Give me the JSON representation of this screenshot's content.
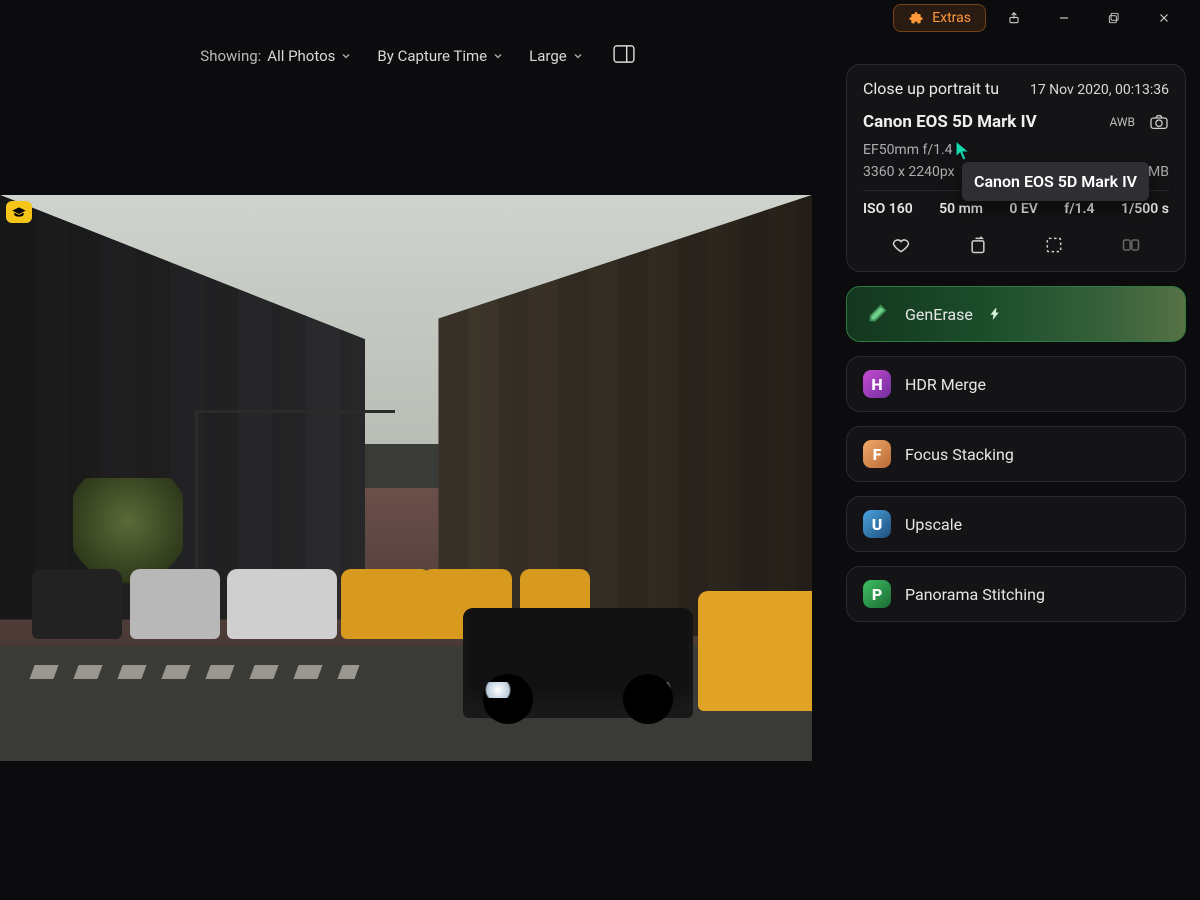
{
  "titlebar": {
    "extras_label": "Extras"
  },
  "toolbar": {
    "showing_prefix": "Showing:",
    "filter": "All Photos",
    "sort": "By Capture Time",
    "size": "Large"
  },
  "info": {
    "title": "Close up portrait tu",
    "date": "17 Nov 2020, 00:13:36",
    "camera": "Canon EOS 5D Mark IV",
    "awb": "AWB",
    "lens": "EF50mm f/1.4",
    "dimensions": "3360 x 2240px",
    "filesize": "2 MB",
    "exif": {
      "iso": "ISO 160",
      "focal": "50 mm",
      "ev": "0 EV",
      "aperture": "f/1.4",
      "shutter": "1/500 s"
    }
  },
  "tools": {
    "generase": "GenErase",
    "hdr": "HDR Merge",
    "focus": "Focus Stacking",
    "upscale": "Upscale",
    "pano": "Panorama Stitching"
  },
  "tooltip": {
    "camera": "Canon EOS 5D Mark IV"
  },
  "tiles": {
    "h": "H",
    "f": "F",
    "u": "U",
    "p": "P"
  }
}
